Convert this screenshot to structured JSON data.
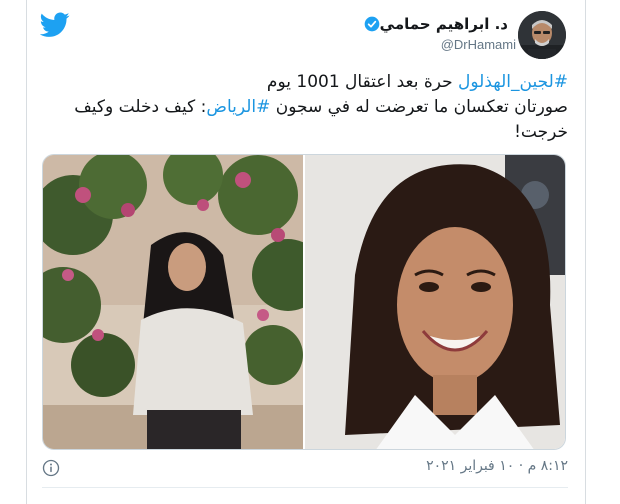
{
  "tweet": {
    "author": {
      "display_name": "د. ابراهيم حمامي",
      "handle": "@DrHamami",
      "verified": true
    },
    "text": {
      "line1_hashtag": "#لجين_الهذلول",
      "line1_rest": " حرة بعد اعتقال 1001 يوم",
      "line2_start": "صورتان تعكسان ما تعرضت له في سجون ",
      "line2_hashtag": "#الرياض",
      "line2_end": ": كيف دخلت وكيف خرجت!"
    },
    "timestamp": "٨:١٢ م · ١٠ فبراير ٢٠٢١"
  },
  "icons": {
    "logo": "twitter-bird-icon",
    "verified": "verified-badge-icon",
    "info": "info-icon"
  },
  "colors": {
    "brand": "#1da1f2",
    "hashtag": "#1b95e0",
    "meta": "#657786",
    "border": "#ccd6dd"
  }
}
